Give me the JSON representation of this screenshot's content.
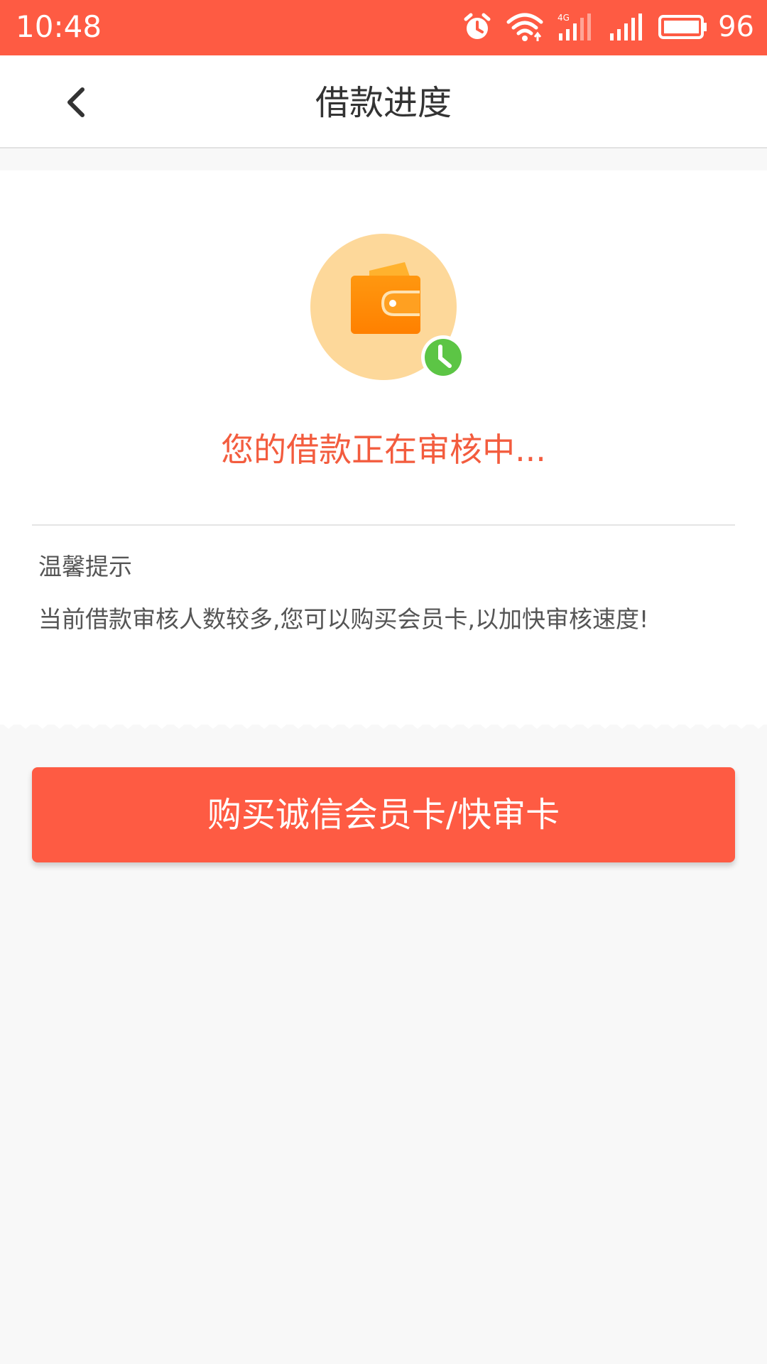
{
  "status_bar": {
    "time": "10:48",
    "battery": "96",
    "icons": [
      "alarm-icon",
      "wifi-icon",
      "signal-4g-icon",
      "signal-icon",
      "battery-icon"
    ]
  },
  "nav": {
    "title": "借款进度",
    "back_icon": "chevron-left-icon"
  },
  "status": {
    "illustration_icons": [
      "wallet-icon",
      "clock-icon"
    ],
    "message": "您的借款正在审核中..."
  },
  "tips": {
    "title": "温馨提示",
    "text": "当前借款审核人数较多,您可以购买会员卡,以加快审核速度!"
  },
  "action": {
    "button_label": "购买诚信会员卡/快审卡"
  },
  "colors": {
    "accent": "#fe5b43",
    "message": "#f35c3e",
    "illustration_bg": "#fdd89a",
    "wallet": "#ff8a00",
    "clock_badge": "#5cc545"
  }
}
